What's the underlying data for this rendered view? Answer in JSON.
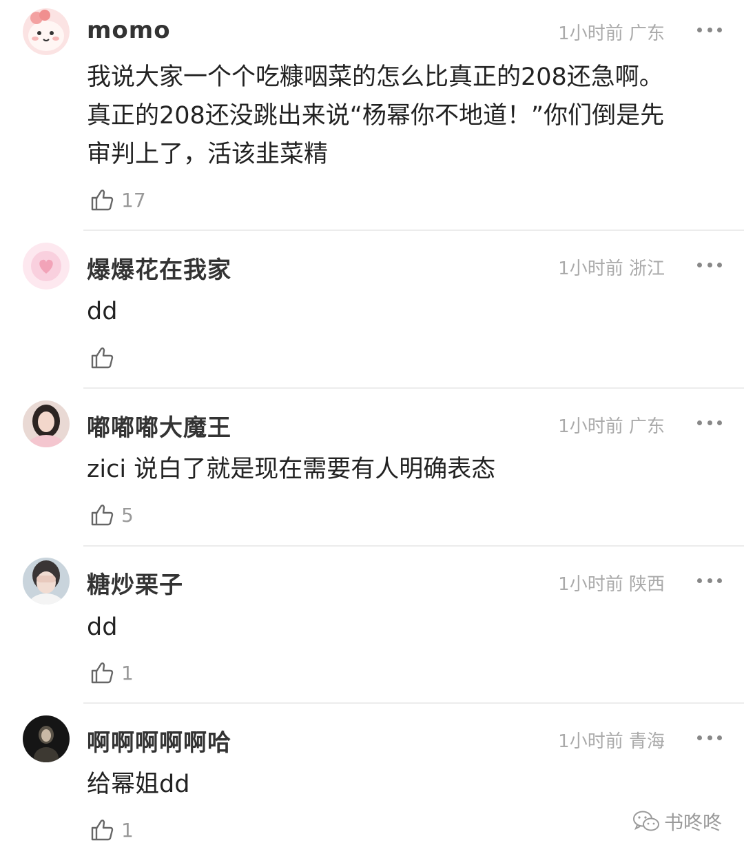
{
  "comments": [
    {
      "avatar_icon": "cartoon-pink-avatar",
      "username": "momo",
      "time": "1小时前",
      "location": "广东",
      "text_lines": [
        "我说大家一个个吃糠咽菜的怎么比真正的208还急啊。",
        "真正的208还没跳出来说“杨幂你不地道！”你们倒是先",
        "审判上了，活该韭菜精"
      ],
      "likes": "17"
    },
    {
      "avatar_icon": "pink-heart-avatar",
      "username": "爆爆花在我家",
      "time": "1小时前",
      "location": "浙江",
      "text_lines": [
        "dd"
      ],
      "likes": ""
    },
    {
      "avatar_icon": "girl-photo-avatar",
      "username": "嘟嘟嘟大魔王",
      "time": "1小时前",
      "location": "广东",
      "text_lines": [
        "zici 说白了就是现在需要有人明确表态"
      ],
      "likes": "5"
    },
    {
      "avatar_icon": "covering-eyes-avatar",
      "username": "糖炒栗子",
      "time": "1小时前",
      "location": "陕西",
      "text_lines": [
        "dd"
      ],
      "likes": "1"
    },
    {
      "avatar_icon": "dark-photo-avatar",
      "username": "啊啊啊啊啊哈",
      "time": "1小时前",
      "location": "青海",
      "text_lines": [
        "给幂姐dd"
      ],
      "likes": "1"
    }
  ],
  "watermark": {
    "icon": "wechat-icon",
    "text": "书咚咚"
  },
  "colors": {
    "username": "#333333",
    "meta": "#aaaaaa",
    "body_text": "#222222",
    "divider": "#ececec"
  }
}
